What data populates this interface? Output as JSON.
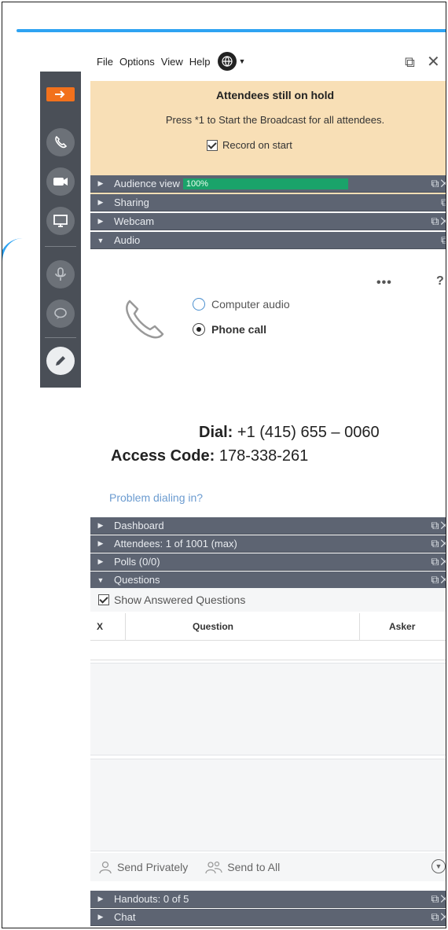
{
  "menu": {
    "file": "File",
    "options": "Options",
    "view": "View",
    "help": "Help",
    "restore_icon": "restore-icon",
    "close_icon": "close-icon"
  },
  "hold_banner": {
    "title": "Attendees still on hold",
    "text": "Press *1 to Start the Broadcast for all attendees.",
    "record_label": "Record on start",
    "record_checked": true
  },
  "sections": {
    "audience_view": {
      "label": "Audience view",
      "progress_text": "100%",
      "progress_fraction": 1.0
    },
    "sharing": {
      "label": "Sharing"
    },
    "webcam": {
      "label": "Webcam"
    },
    "audio": {
      "label": "Audio"
    },
    "dashboard": {
      "label": "Dashboard"
    },
    "attendees": {
      "label": "Attendees:  1 of 1001 (max)"
    },
    "polls": {
      "label": "Polls (0/0)"
    },
    "questions": {
      "label": "Questions"
    },
    "handouts": {
      "label": "Handouts: 0 of 5"
    },
    "chat": {
      "label": "Chat"
    }
  },
  "audio": {
    "more": "•••",
    "help": "?",
    "computer_audio": "Computer audio",
    "phone_call": "Phone call",
    "selected": "phone_call",
    "dial_label": "Dial:",
    "dial_value": " +1 (415) 655 – 0060",
    "access_label": "Access Code:",
    "access_value": " 178-338-261",
    "problem_link": "Problem dialing in?"
  },
  "questions": {
    "show_answered": "Show Answered Questions",
    "show_answered_checked": true,
    "col_x": "X",
    "col_question": "Question",
    "col_asker": "Asker",
    "send_privately": "Send Privately",
    "send_to_all": "Send to All"
  },
  "colors": {
    "accent_blue": "#2ea3f2",
    "toolbar_bg": "#4a4f57",
    "bar_bg": "#5d6472",
    "hold_bg": "#f8dfb6",
    "orange": "#f2711c",
    "progress_green": "#1aa36a"
  }
}
